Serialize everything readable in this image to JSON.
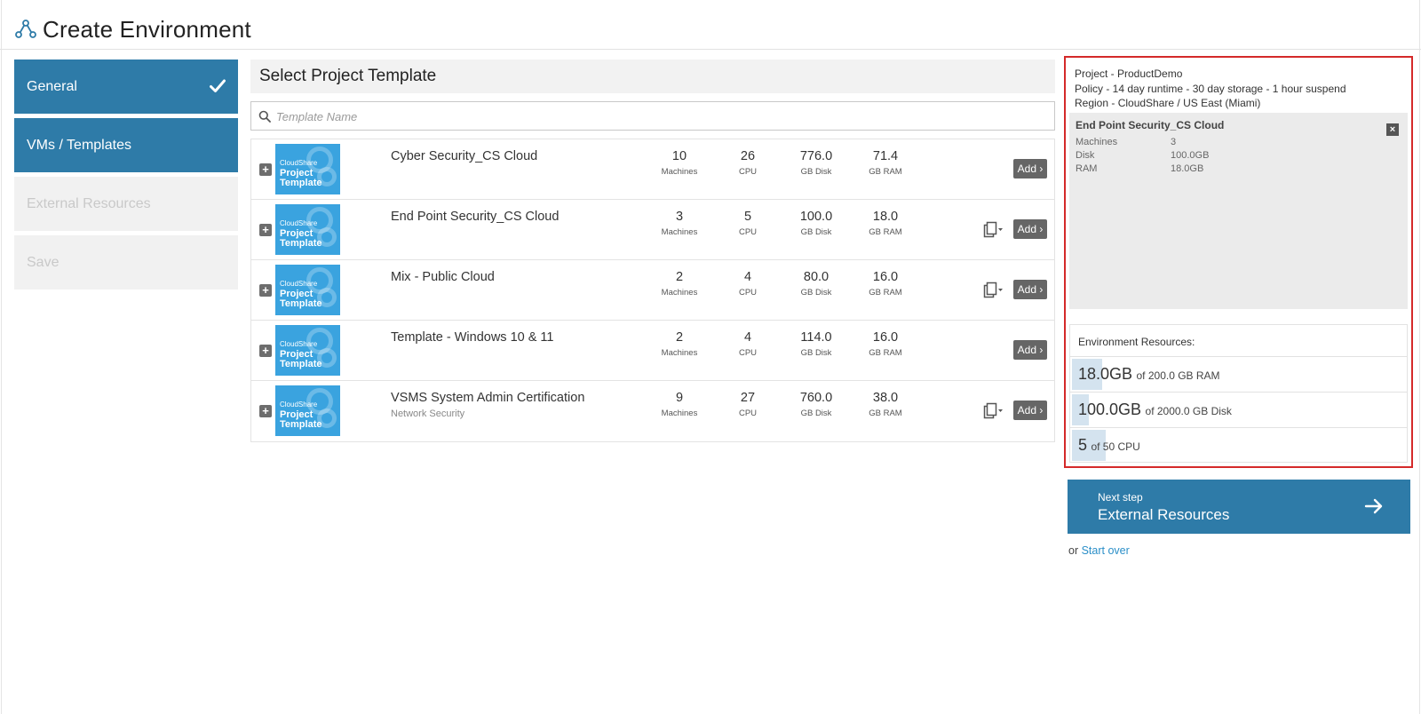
{
  "header": {
    "title": "Create Environment",
    "icon": "network-icon"
  },
  "steps": [
    {
      "label": "General",
      "state": "active",
      "completed": true
    },
    {
      "label": "VMs / Templates",
      "state": "active",
      "completed": false
    },
    {
      "label": "External Resources",
      "state": "disabled"
    },
    {
      "label": "Save",
      "state": "disabled"
    }
  ],
  "section": {
    "title": "Select Project Template"
  },
  "search": {
    "placeholder": "Template Name",
    "value": ""
  },
  "thumbnail": {
    "brand": "CloudShare",
    "line1": "Project",
    "line2": "Template"
  },
  "stat_labels": {
    "machines": "Machines",
    "cpu": "CPU",
    "disk": "GB Disk",
    "ram": "GB RAM"
  },
  "templates": [
    {
      "name": "Cyber Security_CS Cloud",
      "subtitle": "",
      "machines": "10",
      "cpu": "26",
      "disk": "776.0",
      "ram": "71.4",
      "has_copy": false,
      "add_label": "Add ›"
    },
    {
      "name": "End Point Security_CS Cloud",
      "subtitle": "",
      "machines": "3",
      "cpu": "5",
      "disk": "100.0",
      "ram": "18.0",
      "has_copy": true,
      "add_label": "Add ›"
    },
    {
      "name": "Mix - Public Cloud",
      "subtitle": "",
      "machines": "2",
      "cpu": "4",
      "disk": "80.0",
      "ram": "16.0",
      "has_copy": true,
      "add_label": "Add ›"
    },
    {
      "name": "Template - Windows 10 & 11",
      "subtitle": "",
      "machines": "2",
      "cpu": "4",
      "disk": "114.0",
      "ram": "16.0",
      "has_copy": false,
      "add_label": "Add ›"
    },
    {
      "name": "VSMS System Admin Certification",
      "subtitle": "Network Security",
      "machines": "9",
      "cpu": "27",
      "disk": "760.0",
      "ram": "38.0",
      "has_copy": true,
      "add_label": "Add ›"
    }
  ],
  "summary": {
    "project": "Project - ProductDemo",
    "policy": "Policy - 14 day runtime - 30 day storage - 1 hour suspend",
    "region": "Region - CloudShare / US East (Miami)",
    "selected": {
      "title": "End Point Security_CS Cloud",
      "rows": [
        {
          "label": "Machines",
          "value": "3"
        },
        {
          "label": "Disk",
          "value": "100.0GB"
        },
        {
          "label": "RAM",
          "value": "18.0GB"
        }
      ]
    },
    "env_resources": {
      "title": "Environment Resources:",
      "rows": [
        {
          "used": "18.0GB",
          "of": "of 200.0 GB RAM",
          "fraction": 0.09
        },
        {
          "used": "100.0GB",
          "of": "of 2000.0 GB Disk",
          "fraction": 0.05
        },
        {
          "used": "5",
          "of": "of 50 CPU",
          "fraction": 0.1
        }
      ]
    }
  },
  "next": {
    "small": "Next step",
    "big": "External Resources"
  },
  "start_over": {
    "prefix": "or ",
    "link": "Start over"
  },
  "colors": {
    "primary": "#2e7ba8",
    "thumbnail": "#3aa3df",
    "highlight_border": "#d42a2a",
    "link": "#2b8fc8"
  }
}
